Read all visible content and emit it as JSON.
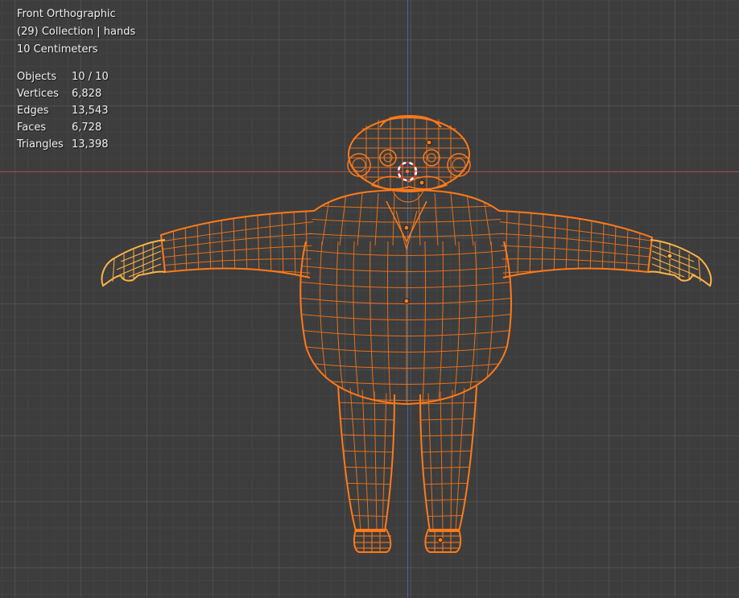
{
  "viewport": {
    "view_name": "Front Orthographic",
    "collection_info": "(29) Collection | hands",
    "grid_scale": "10 Centimeters",
    "stats": [
      {
        "label": "Objects",
        "value": "10 / 10"
      },
      {
        "label": "Vertices",
        "value": "6,828"
      },
      {
        "label": "Edges",
        "value": "13,543"
      },
      {
        "label": "Faces",
        "value": "6,728"
      },
      {
        "label": "Triangles",
        "value": "13,398"
      }
    ]
  },
  "colors": {
    "background": "#3d3d3d",
    "x_axis": "#a84a53",
    "z_axis": "#3d6aa1",
    "selected_wire": "#ff7a1a",
    "active_wire": "#ffb347",
    "text": "#f0f0f0"
  }
}
